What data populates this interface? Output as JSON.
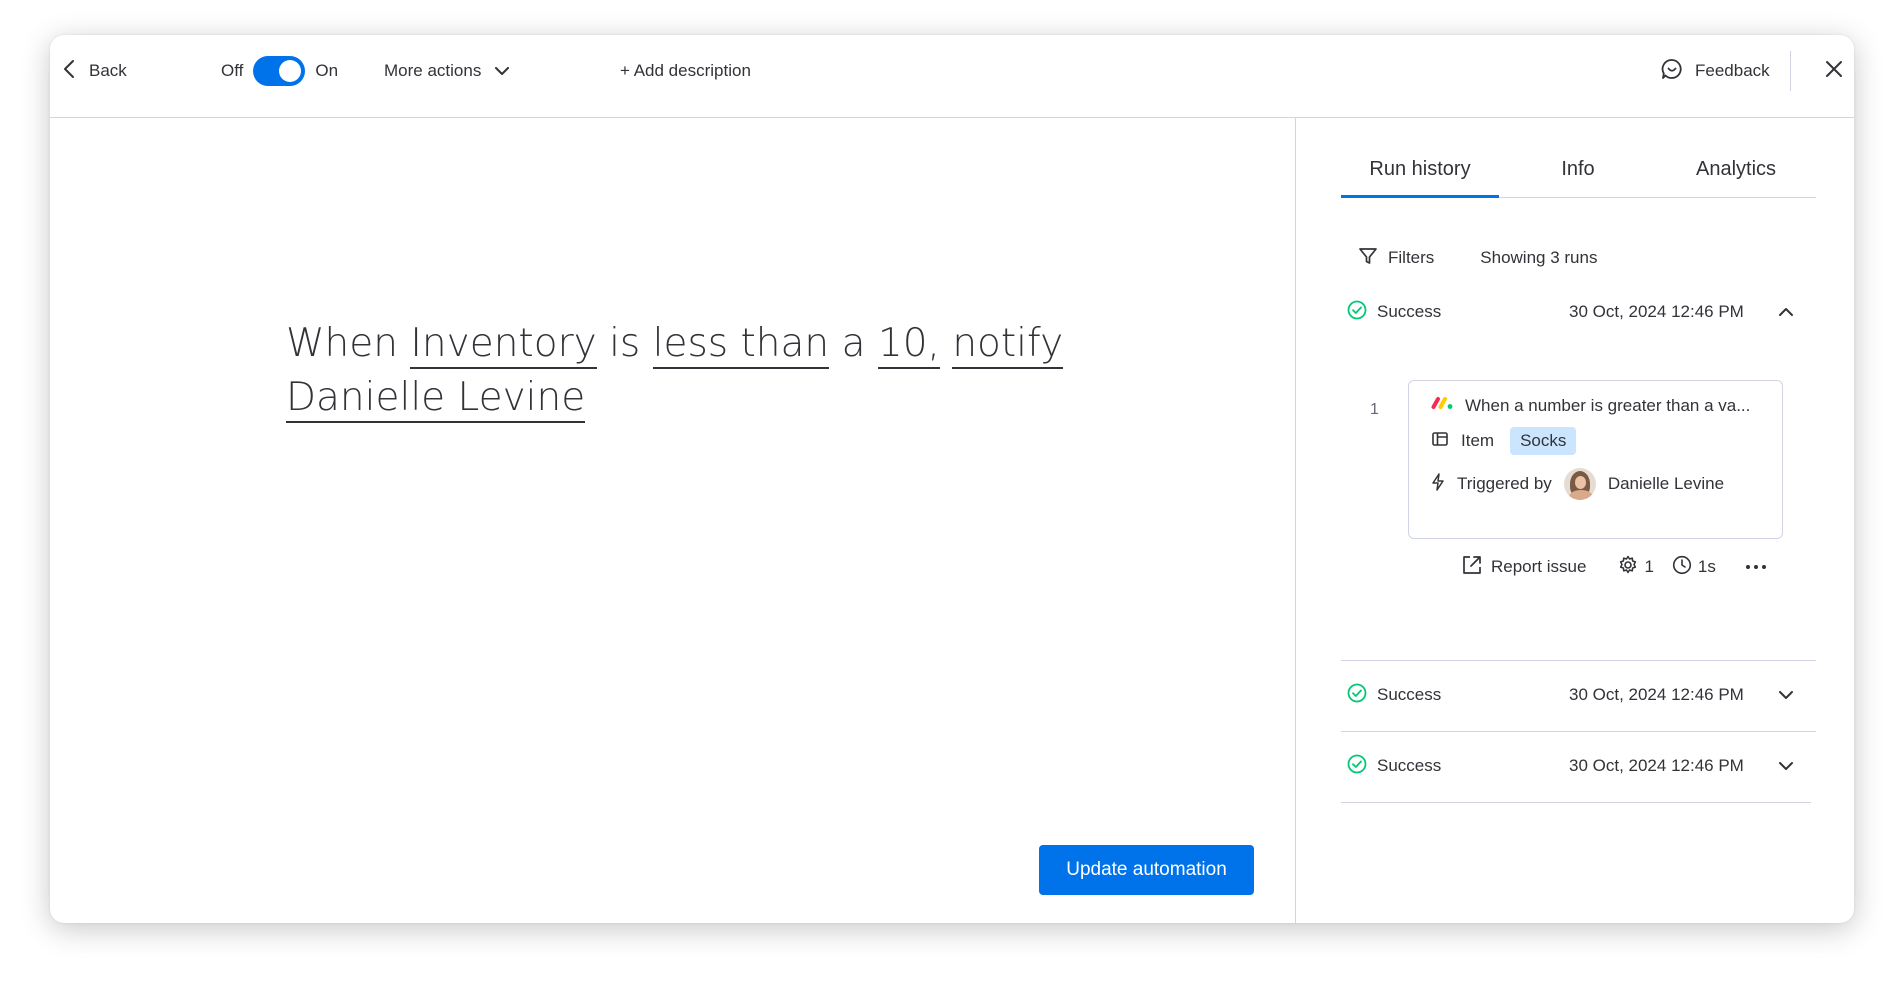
{
  "topbar": {
    "back_label": "Back",
    "toggle_off_label": "Off",
    "toggle_on_label": "On",
    "toggle_state": "on",
    "more_actions_label": "More actions",
    "add_description_label": "+ Add description",
    "feedback_label": "Feedback"
  },
  "recipe": {
    "w1": "When",
    "trigger_column": "Inventory",
    "w2": "is",
    "condition": "less than",
    "w3": "a",
    "value": "10,",
    "action": "notify",
    "recipient": "Danielle Levine"
  },
  "update_button_label": "Update automation",
  "panel": {
    "tabs": [
      {
        "label": "Run history",
        "active": true
      },
      {
        "label": "Info",
        "active": false
      },
      {
        "label": "Analytics",
        "active": false
      }
    ],
    "filters_label": "Filters",
    "showing_label": "Showing 3 runs",
    "runs": [
      {
        "status": "Success",
        "date": "30 Oct, 2024 12:46 PM",
        "expanded": true
      },
      {
        "status": "Success",
        "date": "30 Oct, 2024 12:46 PM",
        "expanded": false
      },
      {
        "status": "Success",
        "date": "30 Oct, 2024 12:46 PM",
        "expanded": false
      }
    ],
    "detail": {
      "index": "1",
      "trigger_text": "When a number is greater than a va...",
      "item_label": "Item",
      "item_value": "Socks",
      "triggered_by_label": "Triggered by",
      "triggered_by_name": "Danielle Levine",
      "report_issue_label": "Report issue",
      "actions_count": "1",
      "duration": "1s"
    }
  },
  "colors": {
    "accent": "#0073ea",
    "success": "#00c875",
    "chip_bg": "#cce5ff",
    "border": "#d0d4e4"
  }
}
